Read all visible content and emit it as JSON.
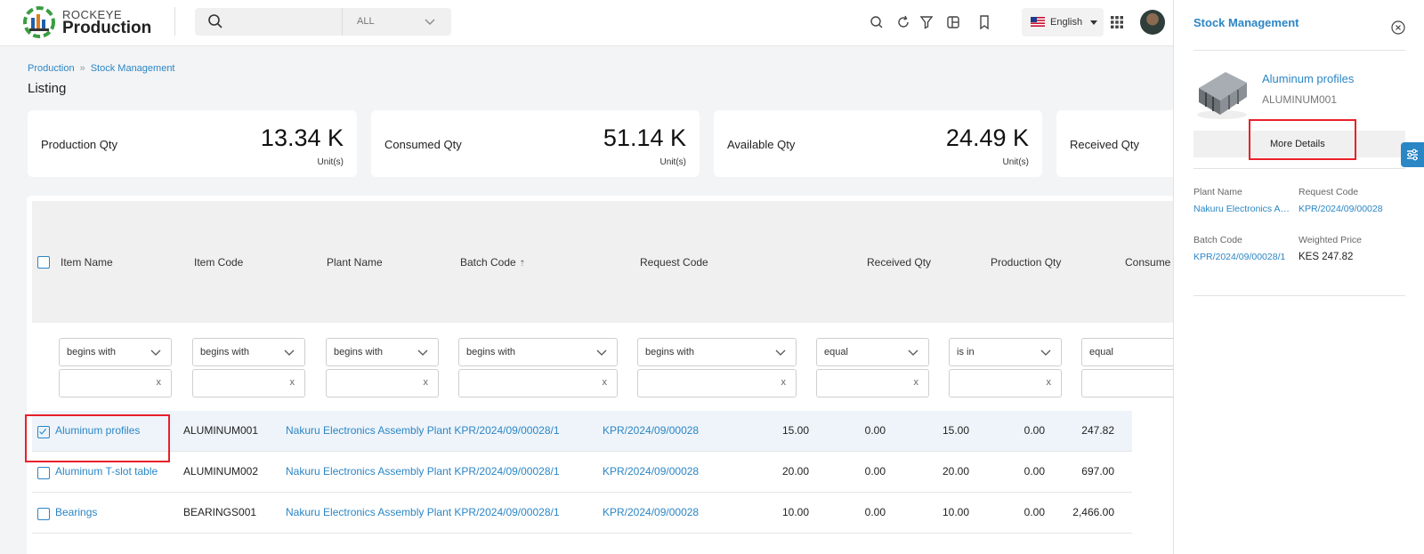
{
  "header": {
    "brand_top": "ROCKEYE",
    "brand_main": "Production",
    "search_scope": "ALL",
    "language": "English"
  },
  "breadcrumb": [
    "Production",
    "Stock Management"
  ],
  "page_title": "Listing",
  "stats": [
    {
      "label": "Production Qty",
      "value": "13.34 K",
      "unit": "Unit(s)"
    },
    {
      "label": "Consumed Qty",
      "value": "51.14 K",
      "unit": "Unit(s)"
    },
    {
      "label": "Available Qty",
      "value": "24.49 K",
      "unit": "Unit(s)"
    },
    {
      "label": "Received Qty"
    }
  ],
  "table": {
    "columns": [
      "Item Name",
      "Item Code",
      "Plant Name",
      "Batch Code",
      "Request Code",
      "Received Qty",
      "Production Qty",
      "Consume"
    ],
    "filters": [
      "begins with",
      "begins with",
      "begins with",
      "begins with",
      "begins with",
      "equal",
      "is in",
      "equal"
    ],
    "clear_mark": "x",
    "rows": [
      {
        "item_name": "Aluminum profiles",
        "item_code": "ALUMINUM001",
        "plant_batch": "Nakuru Electronics Assembly Plant KPR/2024/09/00028/1",
        "request_code": "KPR/2024/09/00028",
        "v1": "15.00",
        "v2": "0.00",
        "v3": "15.00",
        "v4": "0.00",
        "v5": "247.82"
      },
      {
        "item_name": "Aluminum T-slot table",
        "item_code": "ALUMINUM002",
        "plant_batch": "Nakuru Electronics Assembly Plant KPR/2024/09/00028/1",
        "request_code": "KPR/2024/09/00028",
        "v1": "20.00",
        "v2": "0.00",
        "v3": "20.00",
        "v4": "0.00",
        "v5": "697.00"
      },
      {
        "item_name": "Bearings",
        "item_code": "BEARINGS001",
        "plant_batch": "Nakuru Electronics Assembly Plant KPR/2024/09/00028/1",
        "request_code": "KPR/2024/09/00028",
        "v1": "10.00",
        "v2": "0.00",
        "v3": "10.00",
        "v4": "0.00",
        "v5": "2,466.00"
      }
    ]
  },
  "panel": {
    "title": "Stock Management",
    "item_name": "Aluminum profiles",
    "item_code": "ALUMINUM001",
    "more_details": "More Details",
    "plant_name_label": "Plant Name",
    "plant_name": "Nakuru Electronics Assembly Plant",
    "request_code_label": "Request Code",
    "request_code": "KPR/2024/09/00028",
    "batch_code_label": "Batch Code",
    "batch_code": "KPR/2024/09/00028/1",
    "weighted_price_label": "Weighted Price",
    "weighted_price": "KES 247.82"
  }
}
